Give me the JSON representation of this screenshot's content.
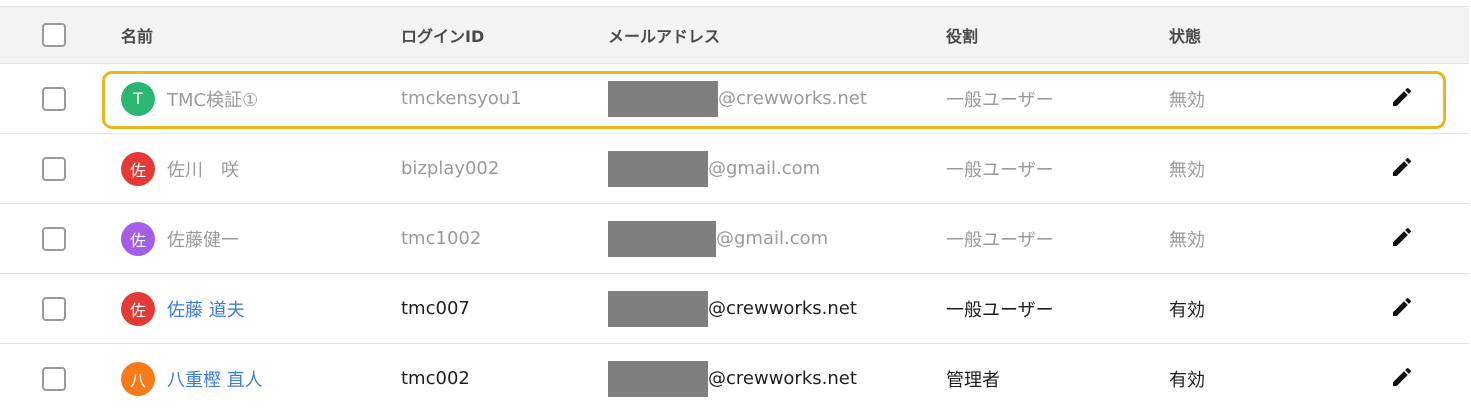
{
  "header": {
    "name": "名前",
    "login_id": "ログインID",
    "email": "メールアドレス",
    "role": "役割",
    "status": "状態"
  },
  "icons": {
    "edit": "pencil-icon",
    "checkbox": "checkbox-unchecked"
  },
  "colors": {
    "highlight": "#e9b71d",
    "link": "#3b7de0",
    "redaction": "#7f7f7f"
  },
  "users": [
    {
      "avatar": "T",
      "avatar_color": "#2bb673",
      "name": "TMC検証①",
      "login_id": "tmckensyou1",
      "email_domain": "@crewworks.net",
      "role": "一般ユーザー",
      "status": "無効",
      "active": false
    },
    {
      "avatar": "佐",
      "avatar_color": "#e53935",
      "name": "佐川　咲",
      "login_id": "bizplay002",
      "email_domain": "@gmail.com",
      "role": "一般ユーザー",
      "status": "無効",
      "active": false
    },
    {
      "avatar": "佐",
      "avatar_color": "#a55ce8",
      "name": "佐藤健一",
      "login_id": "tmc1002",
      "email_domain": "@gmail.com",
      "role": "一般ユーザー",
      "status": "無効",
      "active": false
    },
    {
      "avatar": "佐",
      "avatar_color": "#e53935",
      "name": "佐藤 道夫",
      "login_id": "tmc007",
      "email_domain": "@crewworks.net",
      "role": "一般ユーザー",
      "status": "有効",
      "active": true
    },
    {
      "avatar": "八",
      "avatar_color": "#f57c18",
      "name": "八重樫 直人",
      "login_id": "tmc002",
      "email_domain": "@crewworks.net",
      "role": "管理者",
      "status": "有効",
      "active": true
    }
  ]
}
